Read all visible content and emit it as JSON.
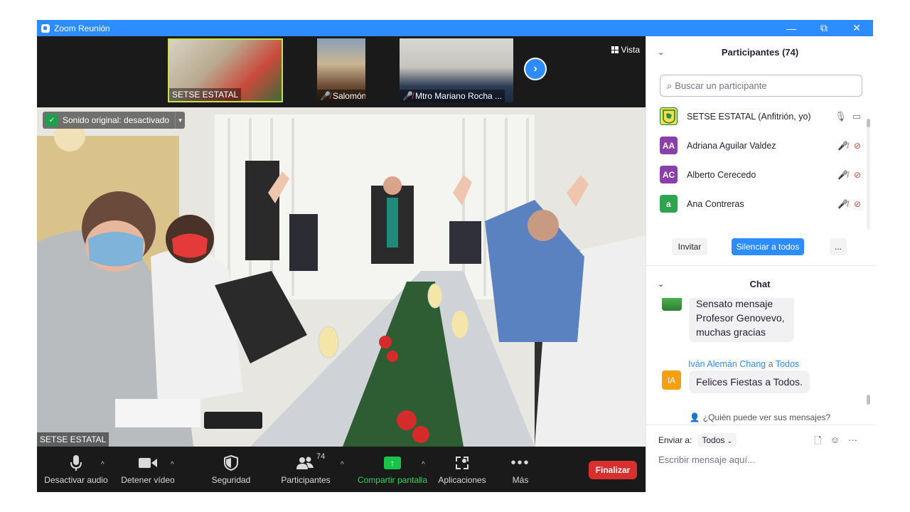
{
  "window": {
    "title": "Zoom Reunión",
    "controls": {
      "minimize": "—",
      "restore": "⧉",
      "close": "✕"
    }
  },
  "strip": {
    "thumbnails": [
      {
        "label": "SETSE ESTATAL",
        "muted": false
      },
      {
        "label": "Salomón",
        "muted": true
      },
      {
        "label": "Mtro Mariano Rocha ...",
        "muted": true
      }
    ],
    "next_icon": "chevron-right",
    "view_label": "Vista"
  },
  "main_video": {
    "original_sound": "Sonido original: desactivado",
    "speaker_label": "SETSE ESTATAL"
  },
  "toolbar": {
    "audio": "Desactivar audio",
    "video": "Detener vídeo",
    "security": "Seguridad",
    "participants": "Participantes",
    "participants_count": "74",
    "share": "Compartir pantalla",
    "apps": "Aplicaciones",
    "more": "Más",
    "end": "Finalizar"
  },
  "participants_panel": {
    "title": "Participantes (74)",
    "search_placeholder": "Buscar un participante",
    "list": [
      {
        "initials": "",
        "name": "SETSE ESTATAL (Anfitrión, yo)",
        "color": "#f4e04d",
        "muted": false
      },
      {
        "initials": "AA",
        "name": "Adriana Aguilar Valdez",
        "color": "#8b3fa8",
        "muted": true
      },
      {
        "initials": "AC",
        "name": "Alberto Cerecedo",
        "color": "#8b3fa8",
        "muted": true
      },
      {
        "initials": "a",
        "name": "Ana Contreras",
        "color": "#2ea44f",
        "muted": true
      }
    ],
    "buttons": {
      "invite": "Invitar",
      "mute_all": "Silenciar a todos",
      "more": "..."
    }
  },
  "chat_panel": {
    "title": "Chat",
    "messages": [
      {
        "sender": "",
        "to": "",
        "text": "Sensato mensaje\nProfesor Genovevo,\nmuchas gracias"
      },
      {
        "sender": "Iván Alemán Chang",
        "connector": "a",
        "to": "Todos",
        "avatar": "IA",
        "avatar_color": "#f4a012",
        "text": "Felices Fiestas a Todos."
      }
    ],
    "who_can_see": "¿Quién puede ver sus mensajes?",
    "send_to_label": "Enviar a:",
    "send_to_value": "Todos",
    "input_placeholder": "Escribir mensaje aquí..."
  },
  "colors": {
    "accent": "#2D8CFF",
    "end": "#d82f2f",
    "share": "#18c34a"
  }
}
